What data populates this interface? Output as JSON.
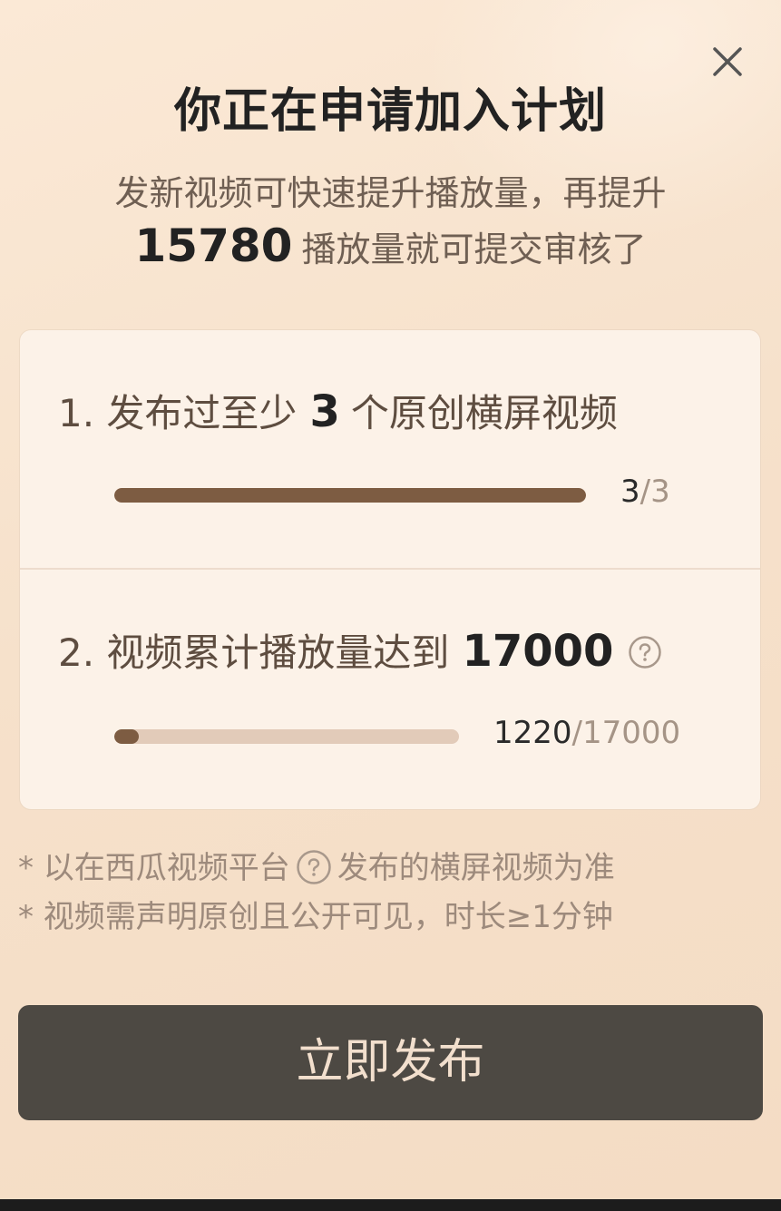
{
  "dialog": {
    "title": "你正在申请加入计划",
    "subtitle_line1": "发新视频可快速提升播放量，再提升",
    "remaining_views": "15780",
    "subtitle_line2_suffix": "播放量就可提交审核了"
  },
  "requirements": [
    {
      "prefix": "1. 发布过至少",
      "target": "3",
      "suffix": "个原创横屏视频",
      "progress_current": "3",
      "progress_total": "/3",
      "progress_fraction": 1.0
    },
    {
      "prefix": "2. 视频累计播放量达到",
      "target": "17000",
      "progress_current": "1220",
      "progress_total": "/17000",
      "progress_fraction": 0.0718
    }
  ],
  "notes": {
    "line1_prefix": "* 以在西瓜视频平台",
    "line1_suffix": "发布的横屏视频为准",
    "line2": "* 视频需声明原创且公开可见，时长≥1分钟"
  },
  "actions": {
    "publish_label": "立即发布"
  },
  "icons": {
    "close": "close-icon",
    "help": "question-circle-icon"
  },
  "colors": {
    "accent_fill": "#7d5c42",
    "track": "#e2cbb9",
    "cta_bg": "#4d4943",
    "cta_text": "#f2dfcd"
  }
}
